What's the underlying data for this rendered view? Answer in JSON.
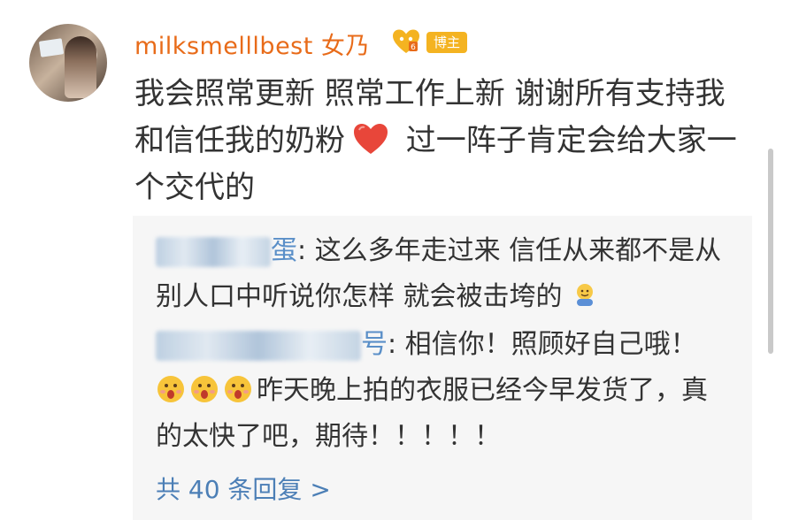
{
  "post": {
    "username": "milksmelllbest 女乃",
    "owner_badge": "博主",
    "text_part1": "我会照常更新 照常工作上新 谢谢所有支持我和信任我的奶粉",
    "text_part2": " 过一阵子肯定会给大家一个交代的"
  },
  "comments": [
    {
      "name_suffix": "蛋",
      "text": ": 这么多年走过来 信任从来都不是从别人口中听说你怎样 就会被击垮的"
    },
    {
      "name_suffix": "号",
      "text_part1": ": 相信你！照顾好自己哦！",
      "text_part2": "昨天晚上拍的衣服已经今早发货了，真的太快了吧，期待！！！！！"
    }
  ],
  "more_replies": "共 40 条回复 >",
  "colors": {
    "username": "#e86b19",
    "link": "#4c7fb6",
    "badge": "#f4b321",
    "comment_bg": "#f6f6f6"
  }
}
